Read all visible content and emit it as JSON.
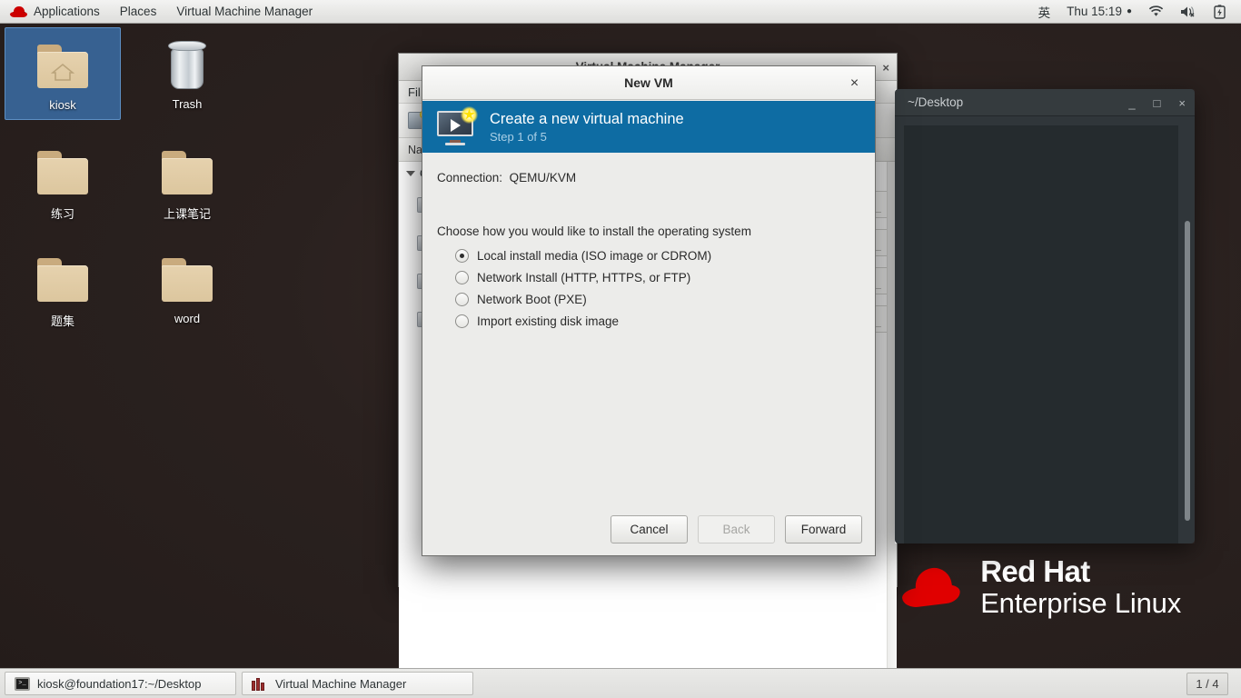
{
  "top_panel": {
    "logo_icon": "redhat-logo-icon",
    "menus": [
      "Applications",
      "Places",
      "Virtual Machine Manager"
    ],
    "input_method": "英",
    "clock": "Thu 15:19",
    "clock_dot": "●",
    "wifi_icon": "wifi-icon",
    "volume_icon": "volume-muted-icon",
    "battery_icon": "battery-charging-icon"
  },
  "desktop": {
    "icons": [
      {
        "label": "kiosk",
        "icon": "home-folder-icon",
        "selected": true
      },
      {
        "label": "Trash",
        "icon": "trash-icon",
        "selected": false
      },
      {
        "label": "练习",
        "icon": "folder-icon",
        "selected": false
      },
      {
        "label": "上课笔记",
        "icon": "folder-icon",
        "selected": false
      },
      {
        "label": "题集",
        "icon": "folder-icon",
        "selected": false
      },
      {
        "label": "word",
        "icon": "folder-icon",
        "selected": false
      }
    ],
    "branding": {
      "line1": "Red Hat",
      "line2": "Enterprise Linux",
      "logo_icon": "redhat-fedora-icon"
    }
  },
  "vmm_window": {
    "title": "Virtual Machine Manager",
    "menu": "Fil",
    "column_header": "Na",
    "group_label": "Q",
    "minimize_label": "_",
    "close_label": "×"
  },
  "terminal_window": {
    "title": "~/Desktop",
    "minimize_label": "_",
    "maximize_label": "□",
    "close_label": "×"
  },
  "dialog": {
    "title": "New VM",
    "close_label": "×",
    "banner": {
      "title": "Create a new virtual machine",
      "step": "Step 1 of 5",
      "icon": "new-vm-monitor-icon",
      "color": "#0e6ca3"
    },
    "connection_label": "Connection:",
    "connection_value": "QEMU/KVM",
    "choose_label": "Choose how you would like to install the operating system",
    "options": [
      {
        "label": "Local install media (ISO image or CDROM)",
        "checked": true
      },
      {
        "label": "Network Install (HTTP, HTTPS, or FTP)",
        "checked": false
      },
      {
        "label": "Network Boot (PXE)",
        "checked": false
      },
      {
        "label": "Import existing disk image",
        "checked": false
      }
    ],
    "buttons": [
      {
        "label": "Cancel",
        "disabled": false
      },
      {
        "label": "Back",
        "disabled": true
      },
      {
        "label": "Forward",
        "disabled": false
      }
    ]
  },
  "taskbar": {
    "items": [
      {
        "label": "kiosk@foundation17:~/Desktop",
        "icon": "terminal-icon"
      },
      {
        "label": "Virtual Machine Manager",
        "icon": "vmm-icon"
      }
    ],
    "workspace": "1 / 4"
  }
}
